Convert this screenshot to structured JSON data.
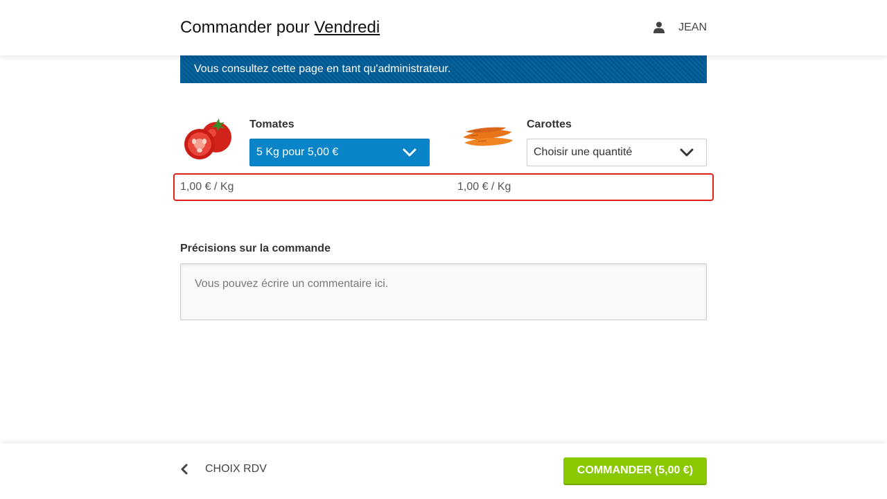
{
  "header": {
    "title_prefix": "Commander pour",
    "day": "Vendredi",
    "user_name": "JEAN"
  },
  "admin_banner": "Vous consultez cette page en tant qu'administrateur.",
  "products": [
    {
      "name": "Tomates",
      "selected": "5 Kg pour 5,00 €",
      "price": "1,00 € / Kg",
      "image": "tomatoes-image"
    },
    {
      "name": "Carottes",
      "selected": "Choisir une quantité",
      "price": "1,00 € / Kg",
      "image": "carrots-image"
    }
  ],
  "comment": {
    "label": "Précisions sur la commande",
    "placeholder": "Vous pouvez écrire un commentaire ici."
  },
  "footer": {
    "back_label": "CHOIX RDV",
    "order_label": "COMMANDER (5,00 €)"
  },
  "colors": {
    "banner": "#005a93",
    "select_active": "#0a84c8",
    "order_button": "#8ac800",
    "highlight_border": "#e0201a"
  }
}
